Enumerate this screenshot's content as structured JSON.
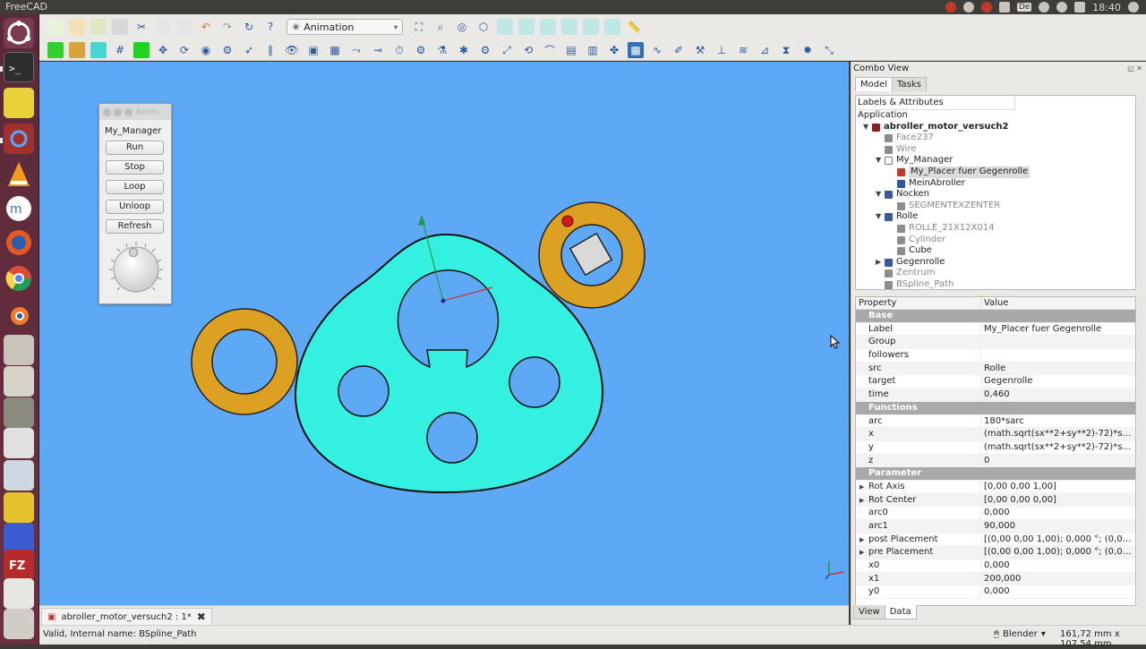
{
  "topbar": {
    "app_title": "FreeCAD",
    "keyboard_layout": "De",
    "clock": "18:40",
    "tray_icons": [
      "chrome-icon",
      "bluetooth-icon",
      "stop-icon",
      "mail-icon",
      "keyboard-icon",
      "network-icon",
      "volume-icon",
      "battery-icon",
      "clock",
      "power-icon"
    ]
  },
  "launcher": {
    "items": [
      "ubuntu-icon",
      "terminal-icon",
      "ruler-app-icon",
      "settings-app-icon",
      "vlc-icon",
      "musescore-icon",
      "firefox-icon",
      "chrome-icon",
      "blender-icon",
      "files-icon",
      "drive-icon",
      "disk-icon",
      "app-icon",
      "text-editor-icon",
      "app-icon",
      "app-icon",
      "filezilla-icon",
      "app-icon",
      "app-icon",
      "trash-icon"
    ]
  },
  "toolbar": {
    "workbench_selector": "Animation",
    "workbench_icon": "animation-icon"
  },
  "anim_panel": {
    "title": "Anim",
    "manager_label": "My_Manager",
    "buttons": {
      "run": "Run",
      "stop": "Stop",
      "loop": "Loop",
      "unloop": "Unloop",
      "refresh": "Refresh"
    }
  },
  "combo": {
    "title": "Combo View",
    "tabs": [
      "Model",
      "Tasks"
    ],
    "tree_header": "Labels & Attributes",
    "tree": [
      {
        "label": "Application",
        "indent": 0,
        "expander": "",
        "icon": "",
        "style": ""
      },
      {
        "label": "abroller_motor_versuch2",
        "indent": 1,
        "expander": "▼",
        "icon": "document-icon",
        "style": "bold"
      },
      {
        "label": "Face237",
        "indent": 2,
        "expander": "",
        "icon": "shape-icon",
        "style": "dim"
      },
      {
        "label": "Wire",
        "indent": 2,
        "expander": "",
        "icon": "shape-icon",
        "style": "dim"
      },
      {
        "label": "My_Manager",
        "indent": 2,
        "expander": "▼",
        "icon": "manager-icon",
        "style": ""
      },
      {
        "label": "My_Placer fuer Gegenrolle",
        "indent": 3,
        "expander": "",
        "icon": "placer-icon",
        "style": "sel"
      },
      {
        "label": "MeinAbroller",
        "indent": 3,
        "expander": "",
        "icon": "roller-icon",
        "style": ""
      },
      {
        "label": "Nocken",
        "indent": 2,
        "expander": "▼",
        "icon": "part-icon",
        "style": ""
      },
      {
        "label": "SEGMENTEXZENTER",
        "indent": 3,
        "expander": "",
        "icon": "shape-icon",
        "style": "dim"
      },
      {
        "label": "Rolle",
        "indent": 2,
        "expander": "▼",
        "icon": "part-icon",
        "style": ""
      },
      {
        "label": "ROLLE_21X12X014",
        "indent": 3,
        "expander": "",
        "icon": "shape-icon",
        "style": "dim"
      },
      {
        "label": "Cylinder",
        "indent": 3,
        "expander": "",
        "icon": "shape-icon",
        "style": "dim"
      },
      {
        "label": "Cube",
        "indent": 3,
        "expander": "",
        "icon": "shape-icon",
        "style": ""
      },
      {
        "label": "Gegenrolle",
        "indent": 2,
        "expander": "▶",
        "icon": "part-icon",
        "style": ""
      },
      {
        "label": "Zentrum",
        "indent": 2,
        "expander": "",
        "icon": "shape-icon",
        "style": "dim"
      },
      {
        "label": "BSpline_Path",
        "indent": 2,
        "expander": "",
        "icon": "shape-icon",
        "style": "dim"
      }
    ],
    "prop_headers": [
      "Property",
      "Value"
    ],
    "props": [
      {
        "name": "Base",
        "value": "",
        "group": true
      },
      {
        "name": "Label",
        "value": "My_Placer fuer Gegenrolle"
      },
      {
        "name": "Group",
        "value": ""
      },
      {
        "name": "followers",
        "value": ""
      },
      {
        "name": "src",
        "value": "Rolle"
      },
      {
        "name": "target",
        "value": "Gegenrolle"
      },
      {
        "name": "time",
        "value": "0,460"
      },
      {
        "name": "Functions",
        "value": "",
        "group": true
      },
      {
        "name": "arc",
        "value": "180*sarc"
      },
      {
        "name": "x",
        "value": "(math.sqrt(sx**2+sy**2)-72)*sx/ma..."
      },
      {
        "name": "y",
        "value": "(math.sqrt(sx**2+sy**2)-72)*sy/ma..."
      },
      {
        "name": "z",
        "value": "0"
      },
      {
        "name": "Parameter",
        "value": "",
        "group": true
      },
      {
        "name": "Rot Axis",
        "value": "[0,00 0,00 1,00]",
        "expander": "▶"
      },
      {
        "name": "Rot Center",
        "value": "[0,00 0,00 0,00]",
        "expander": "▶"
      },
      {
        "name": "arc0",
        "value": "0,000"
      },
      {
        "name": "arc1",
        "value": "90,000"
      },
      {
        "name": "post Placement",
        "value": "[(0,00 0,00 1,00); 0,000 °; (0,000 m...",
        "expander": "▶"
      },
      {
        "name": "pre Placement",
        "value": "[(0,00 0,00 1,00); 0,000 °; (0,000 m...",
        "expander": "▶"
      },
      {
        "name": "x0",
        "value": "0,000"
      },
      {
        "name": "x1",
        "value": "200,000"
      },
      {
        "name": "y0",
        "value": "0,000"
      }
    ],
    "bottom_tabs": [
      "View",
      "Data"
    ]
  },
  "document_tab": {
    "label": "abroller_motor_versuch2 : 1*"
  },
  "statusbar": {
    "message": "Valid, Internal name: BSpline_Path",
    "nav_style": "Blender",
    "dimensions": "161,72 mm x 107,54 mm"
  },
  "colors": {
    "viewport_bg": "#5ea9f6",
    "cam_fill": "#33f0e0",
    "roller_fill": "#dca022",
    "launcher_bg": "#5e2b3b"
  }
}
